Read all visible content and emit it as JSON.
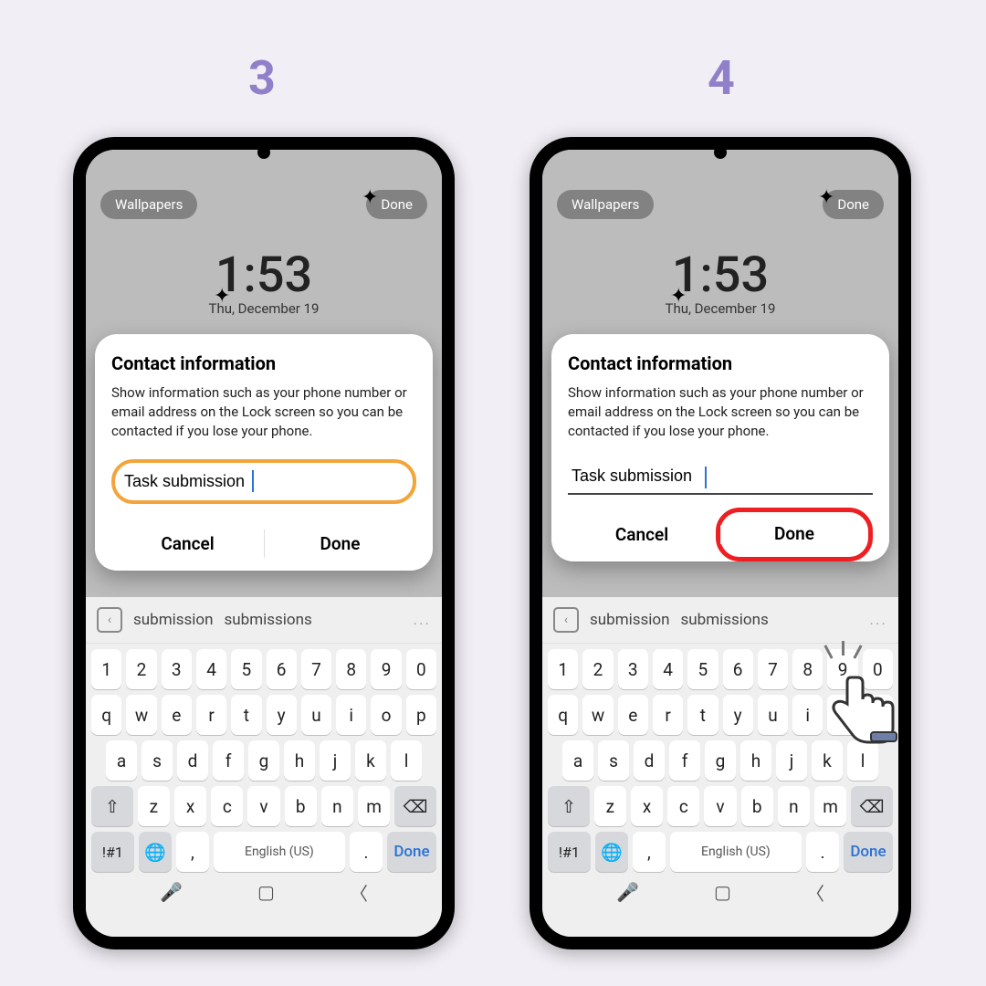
{
  "steps": {
    "left": "3",
    "right": "4"
  },
  "topbar": {
    "wallpapers": "Wallpapers",
    "done": "Done"
  },
  "clock": {
    "time": "1:53",
    "date": "Thu, December 19"
  },
  "dialog": {
    "title": "Contact information",
    "body": "Show information such as your phone number or email address on the Lock screen so you can be contacted if you lose your phone.",
    "input_value": "Task submission",
    "cancel": "Cancel",
    "done": "Done"
  },
  "suggest": {
    "w1": "submission",
    "w2": "submissions",
    "more": "..."
  },
  "keyboard": {
    "row1": [
      "1",
      "2",
      "3",
      "4",
      "5",
      "6",
      "7",
      "8",
      "9",
      "0"
    ],
    "row2": [
      "q",
      "w",
      "e",
      "r",
      "t",
      "y",
      "u",
      "i",
      "o",
      "p"
    ],
    "row3": [
      "a",
      "s",
      "d",
      "f",
      "g",
      "h",
      "j",
      "k",
      "l"
    ],
    "row4": [
      "z",
      "x",
      "c",
      "v",
      "b",
      "n",
      "m"
    ],
    "shift": "⇧",
    "backspace": "⌫",
    "sym": "!#1",
    "globe": "🌐",
    "comma": ",",
    "space": "English (US)",
    "period": ".",
    "done": "Done",
    "mic": "🎤",
    "nav_square": "▢",
    "nav_back": "〈"
  }
}
